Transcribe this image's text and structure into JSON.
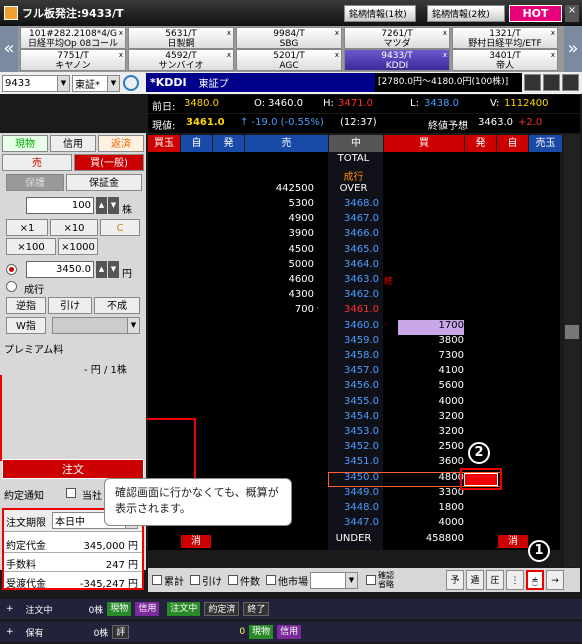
{
  "window": {
    "title": "フル板発注:9433/T"
  },
  "top_buttons": {
    "info1": "銘柄情報(1枚)",
    "info2": "銘柄情報(2枚)",
    "hot": "HOT",
    "close": "×"
  },
  "tabs_row1": [
    {
      "code": "101#282.2108*4/G",
      "name": "日経平均Op 08コール"
    },
    {
      "code": "5631/T",
      "name": "日製鋼"
    },
    {
      "code": "9984/T",
      "name": "SBG"
    },
    {
      "code": "7261/T",
      "name": "マツダ"
    },
    {
      "code": "1321/T",
      "name": "野村日経平均/ETF"
    }
  ],
  "tabs_row2": [
    {
      "code": "7751/T",
      "name": "キヤノン"
    },
    {
      "code": "4592/T",
      "name": "サンバイオ"
    },
    {
      "code": "5201/T",
      "name": "AGC"
    },
    {
      "code": "9433/T",
      "name": "KDDI"
    },
    {
      "code": "3401/T",
      "name": "帝人"
    }
  ],
  "symbol": {
    "code": "9433",
    "market": "東証*",
    "name": "*KDDI",
    "exchange": "東証プ",
    "range": "[2780.0円〜4180.0円(100株)]"
  },
  "info": {
    "prev_label": "前日:",
    "prev": "3480.0",
    "open_label": "O:",
    "open": "3460.0",
    "high_label": "H:",
    "high": "3471.0",
    "low_label": "L:",
    "low": "3438.0",
    "vol_label": "V:",
    "vol": "1112400",
    "cur_label": "現値:",
    "cur": "3461.0",
    "change": "↑ -19.0 (-0.55%)",
    "time": "(12:37)",
    "close_est_label": "終値予想",
    "close_est": "3463.0",
    "close_est_diff": "+2.0"
  },
  "headers": [
    "買玉",
    "自",
    "発",
    "売",
    "中",
    "買",
    "発",
    "自",
    "売玉"
  ],
  "board": {
    "total": "TOTAL",
    "market": "成行",
    "over_qty": "442500",
    "over": "OVER",
    "under": "UNDER",
    "under_qty": "458800",
    "cancel": "消",
    "rows": [
      {
        "sell": "5300",
        "price": "3468.0",
        "buy": ""
      },
      {
        "sell": "4900",
        "price": "3467.0",
        "buy": ""
      },
      {
        "sell": "3900",
        "price": "3466.0",
        "buy": ""
      },
      {
        "sell": "4500",
        "price": "3465.0",
        "buy": ""
      },
      {
        "sell": "5000",
        "price": "3464.0",
        "buy": ""
      },
      {
        "sell": "4600",
        "price": "3463.0",
        "buy": ""
      },
      {
        "sell": "4300",
        "price": "3462.0",
        "buy": ""
      },
      {
        "sell": "700",
        "price": "3461.0",
        "buy": ""
      },
      {
        "sell": "",
        "price": "3460.0",
        "buy": "1700"
      },
      {
        "sell": "",
        "price": "3459.0",
        "buy": "3800"
      },
      {
        "sell": "",
        "price": "3458.0",
        "buy": "7300"
      },
      {
        "sell": "",
        "price": "3457.0",
        "buy": "4100"
      },
      {
        "sell": "",
        "price": "3456.0",
        "buy": "5600"
      },
      {
        "sell": "",
        "price": "3455.0",
        "buy": "4000"
      },
      {
        "sell": "",
        "price": "3454.0",
        "buy": "3200"
      },
      {
        "sell": "",
        "price": "3453.0",
        "buy": "3200"
      },
      {
        "sell": "",
        "price": "3452.0",
        "buy": "2500"
      },
      {
        "sell": "",
        "price": "3451.0",
        "buy": "3600"
      },
      {
        "sell": "",
        "price": "3450.0",
        "buy": "4800"
      },
      {
        "sell": "",
        "price": "3449.0",
        "buy": "3300"
      },
      {
        "sell": "",
        "price": "3448.0",
        "buy": "1800"
      },
      {
        "sell": "",
        "price": "3447.0",
        "buy": "4000"
      }
    ],
    "close_mark": "終"
  },
  "left": {
    "tab_spot": "現物",
    "tab_margin": "信用",
    "tab_repay": "返済",
    "sell": "売",
    "buy": "買(一般)",
    "deposit": "保護",
    "margin": "保証金",
    "qty": "100",
    "qty_unit": "株",
    "mult": [
      "×1",
      "×10",
      "C",
      "×100",
      "×1000"
    ],
    "price": "3450.0",
    "price_unit": "円",
    "market_order": "成行",
    "cond": [
      "逆指",
      "引け",
      "不成"
    ],
    "wcond": "W指",
    "premium": "プレミアム料",
    "premium_val": "- 円 / 1株",
    "term_label": "注文期限",
    "term": "本日中",
    "contract_label": "約定代金",
    "contract": "345,000 円",
    "fee_label": "手数料",
    "fee": "247 円",
    "settle_label": "受渡代金",
    "settle": "-345,247 円",
    "order": "注文",
    "notify": "約定通知",
    "notify2": "当社"
  },
  "callout": "確認画面に行かなくても、概算が表示されます。",
  "bottom": {
    "cum": "累計",
    "close": "引け",
    "count": "件数",
    "other": "他市場",
    "confirm": "確認省略"
  },
  "status1": {
    "label": "注文中",
    "qty": "0株",
    "a": "現物",
    "b": "信用",
    "c": "注文中",
    "d": "約定済",
    "e": "終了"
  },
  "status2": {
    "label": "保有",
    "qty": "0株",
    "a": "評",
    "n": "0",
    "b": "現物",
    "c": "信用"
  },
  "markers": {
    "one": "1",
    "two": "2"
  }
}
